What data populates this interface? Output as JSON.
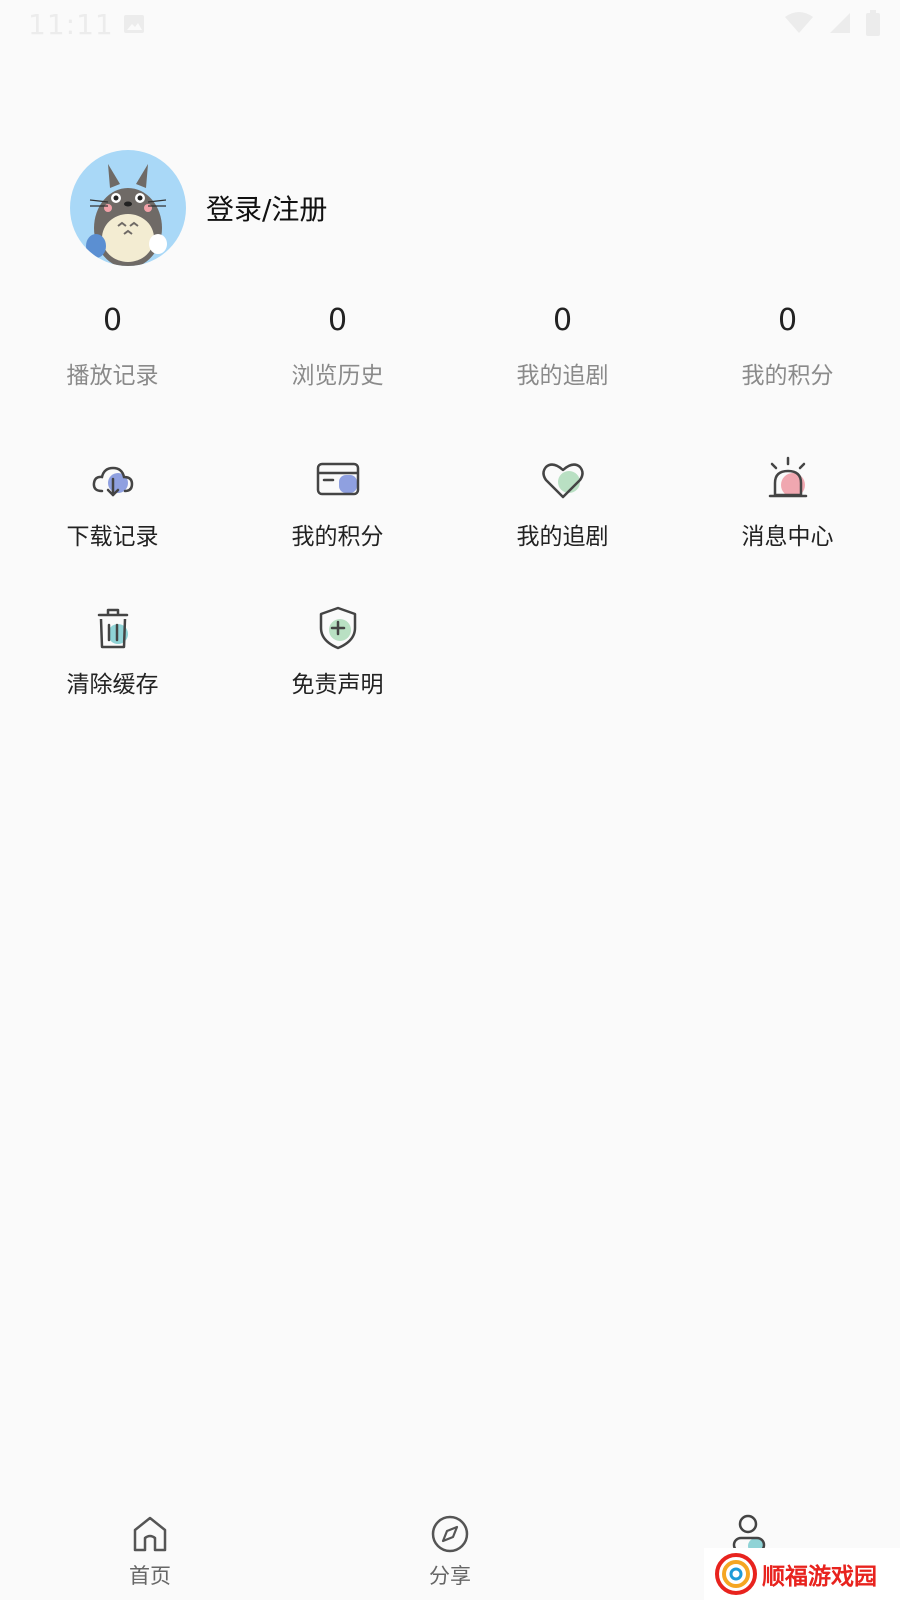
{
  "status_bar": {
    "time": "11:11"
  },
  "profile": {
    "login_label": "登录/注册"
  },
  "stats": [
    {
      "value": "0",
      "label": "播放记录"
    },
    {
      "value": "0",
      "label": "浏览历史"
    },
    {
      "value": "0",
      "label": "我的追剧"
    },
    {
      "value": "0",
      "label": "我的积分"
    }
  ],
  "menu": [
    {
      "label": "下载记录",
      "icon": "cloud-download-icon",
      "accent": "#8fa0e0"
    },
    {
      "label": "我的积分",
      "icon": "card-icon",
      "accent": "#8fa0e0"
    },
    {
      "label": "我的追剧",
      "icon": "heart-icon",
      "accent": "#b9e0c3"
    },
    {
      "label": "消息中心",
      "icon": "alarm-icon",
      "accent": "#f0a7b0"
    },
    {
      "label": "清除缓存",
      "icon": "trash-icon",
      "accent": "#8fd3d6"
    },
    {
      "label": "免责声明",
      "icon": "shield-icon",
      "accent": "#b9e0c3"
    }
  ],
  "tabbar": [
    {
      "label": "首页",
      "icon": "home-icon"
    },
    {
      "label": "分享",
      "icon": "compass-icon"
    },
    {
      "label": "",
      "icon": "user-icon"
    }
  ],
  "watermark": {
    "text": "顺福游戏园"
  }
}
